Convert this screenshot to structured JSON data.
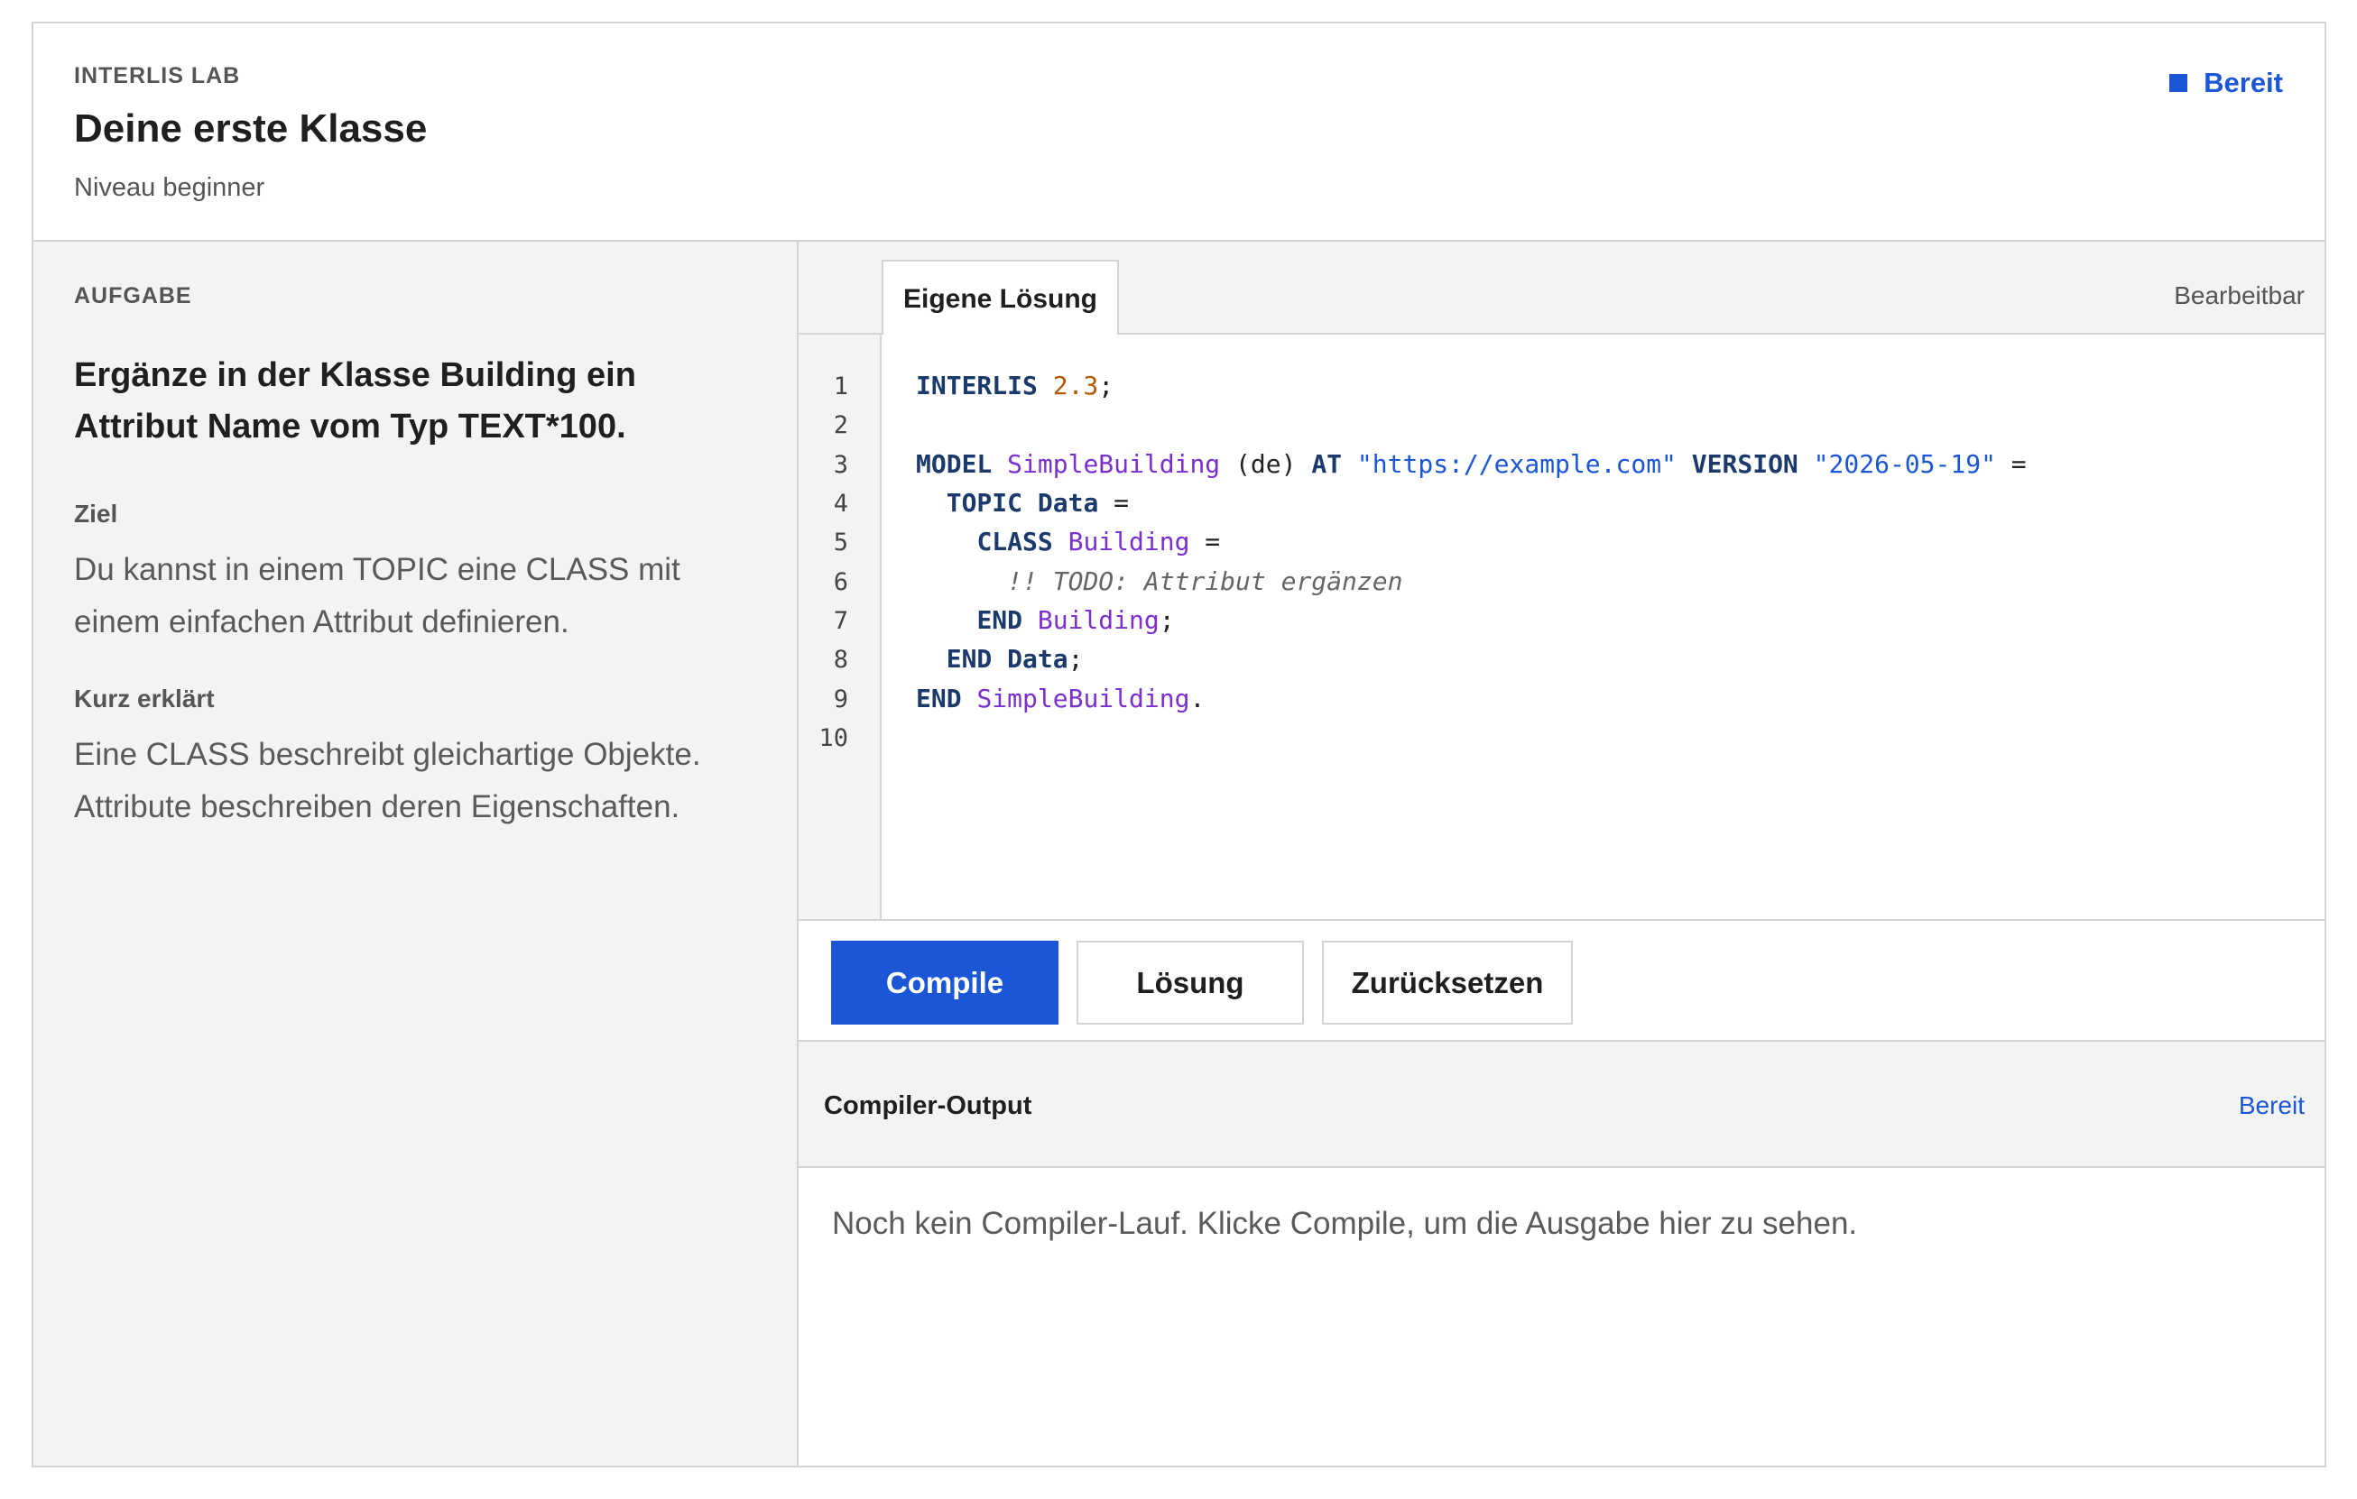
{
  "header": {
    "eyebrow": "INTERLIS LAB",
    "title": "Deine erste Klasse",
    "level": "Niveau beginner",
    "status": "Bereit"
  },
  "task": {
    "label": "AUFGABE",
    "heading": "Ergänze in der Klasse Building ein Attribut Name vom Typ TEXT*100.",
    "goal_label": "Ziel",
    "goal_text": "Du kannst in einem TOPIC eine CLASS mit einem einfachen Attribut definieren.",
    "explain_label": "Kurz erklärt",
    "explain_text": "Eine CLASS beschreibt gleichartige Objekte. Attribute beschreiben deren Eigenschaften."
  },
  "editor": {
    "tab_label": "Eigene Lösung",
    "mode": "Bearbeitbar",
    "line_numbers": [
      "1",
      "2",
      "3",
      "4",
      "5",
      "6",
      "7",
      "8",
      "9",
      "10"
    ],
    "lines": {
      "l1": {
        "kw": "INTERLIS",
        "num": "2.3",
        "end": ";"
      },
      "l3": {
        "kw1": "MODEL",
        "id": "SimpleBuilding",
        "lang": "(de)",
        "kw2": "AT",
        "url": "\"https://example.com\"",
        "kw3": "VERSION",
        "ver": "\"2026-05-19\"",
        "end": " ="
      },
      "l4": {
        "kw": "TOPIC",
        "id": "Data",
        "end": " ="
      },
      "l5": {
        "kw": "CLASS",
        "id": "Building",
        "end": " ="
      },
      "l6": {
        "comment": "!! TODO: Attribut ergänzen"
      },
      "l7": {
        "kw": "END",
        "id": "Building",
        "end": ";"
      },
      "l8": {
        "kw": "END",
        "id": "Data",
        "end": ";"
      },
      "l9": {
        "kw": "END",
        "id": "SimpleBuilding",
        "end": "."
      }
    }
  },
  "toolbar": {
    "compile": "Compile",
    "solution": "Lösung",
    "reset": "Zurücksetzen"
  },
  "output": {
    "title": "Compiler-Output",
    "status": "Bereit",
    "message": "Noch kein Compiler-Lauf. Klicke Compile, um die Ausgabe hier zu sehen."
  },
  "colors": {
    "accent": "#1a56d6",
    "keyword": "#1b3a6b",
    "identifier": "#7a2fd0",
    "number": "#b35a00",
    "panel_bg": "#f3f3f3"
  }
}
